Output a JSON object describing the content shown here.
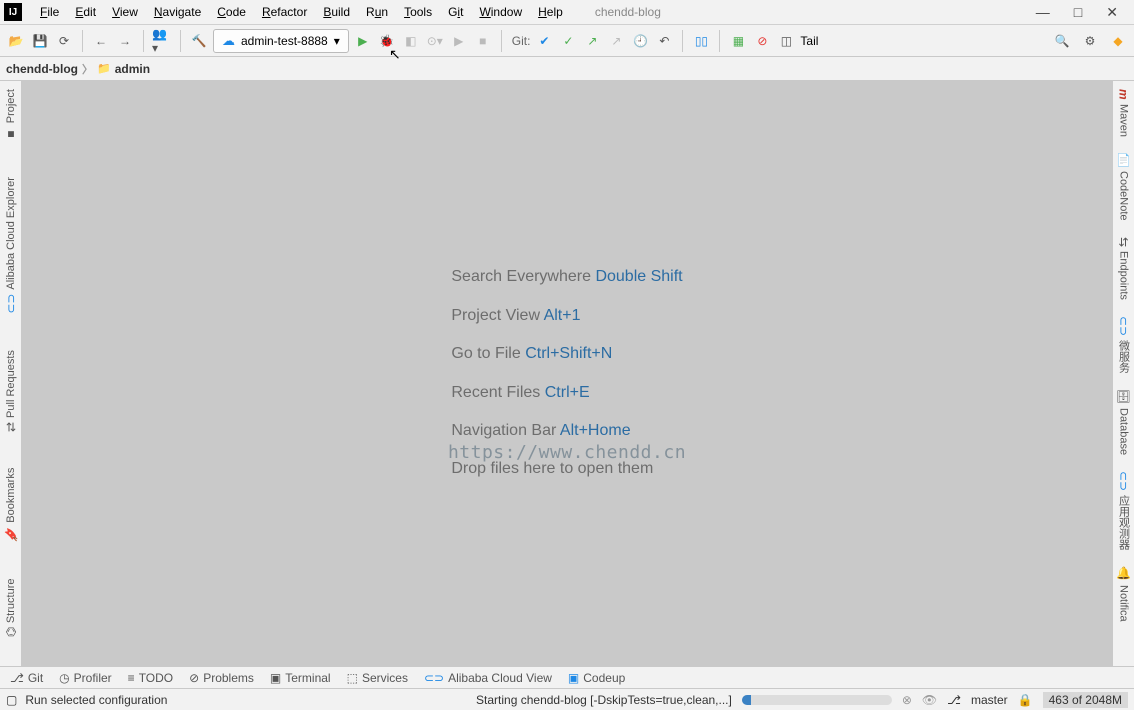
{
  "window": {
    "project": "chendd-blog",
    "controls": {
      "min": "—",
      "max": "□",
      "close": "✕"
    }
  },
  "menu": [
    "File",
    "Edit",
    "View",
    "Navigate",
    "Code",
    "Refactor",
    "Build",
    "Run",
    "Tools",
    "Git",
    "Window",
    "Help"
  ],
  "toolbar": {
    "run_config": "admin-test-8888",
    "git_label": "Git:",
    "tail_label": "Tail"
  },
  "breadcrumb": {
    "root": "chendd-blog",
    "child": "admin"
  },
  "left_tabs": [
    {
      "label": "Project"
    },
    {
      "label": "Alibaba Cloud Explorer"
    },
    {
      "label": "Pull Requests"
    },
    {
      "label": "Bookmarks"
    },
    {
      "label": "Structure"
    }
  ],
  "right_tabs": [
    {
      "label": "Maven"
    },
    {
      "label": "CodeNote"
    },
    {
      "label": "Endpoints"
    },
    {
      "label": "微服务"
    },
    {
      "label": "Database"
    },
    {
      "label": "应用观测器"
    },
    {
      "label": "Notifica"
    }
  ],
  "hints": [
    {
      "text": "Search Everywhere",
      "key": "Double Shift"
    },
    {
      "text": "Project View",
      "key": "Alt+1"
    },
    {
      "text": "Go to File",
      "key": "Ctrl+Shift+N"
    },
    {
      "text": "Recent Files",
      "key": "Ctrl+E"
    },
    {
      "text": "Navigation Bar",
      "key": "Alt+Home"
    },
    {
      "text": "Drop files here to open them",
      "key": ""
    }
  ],
  "watermark": "https://www.chendd.cn",
  "bottom_tabs": [
    {
      "label": "Git"
    },
    {
      "label": "Profiler"
    },
    {
      "label": "TODO"
    },
    {
      "label": "Problems"
    },
    {
      "label": "Terminal"
    },
    {
      "label": "Services"
    },
    {
      "label": "Alibaba Cloud View"
    },
    {
      "label": "Codeup"
    }
  ],
  "status": {
    "hint": "Run selected configuration",
    "task": "Starting chendd-blog [-DskipTests=true,clean,...]",
    "branch": "master",
    "memory": "463 of 2048M"
  }
}
